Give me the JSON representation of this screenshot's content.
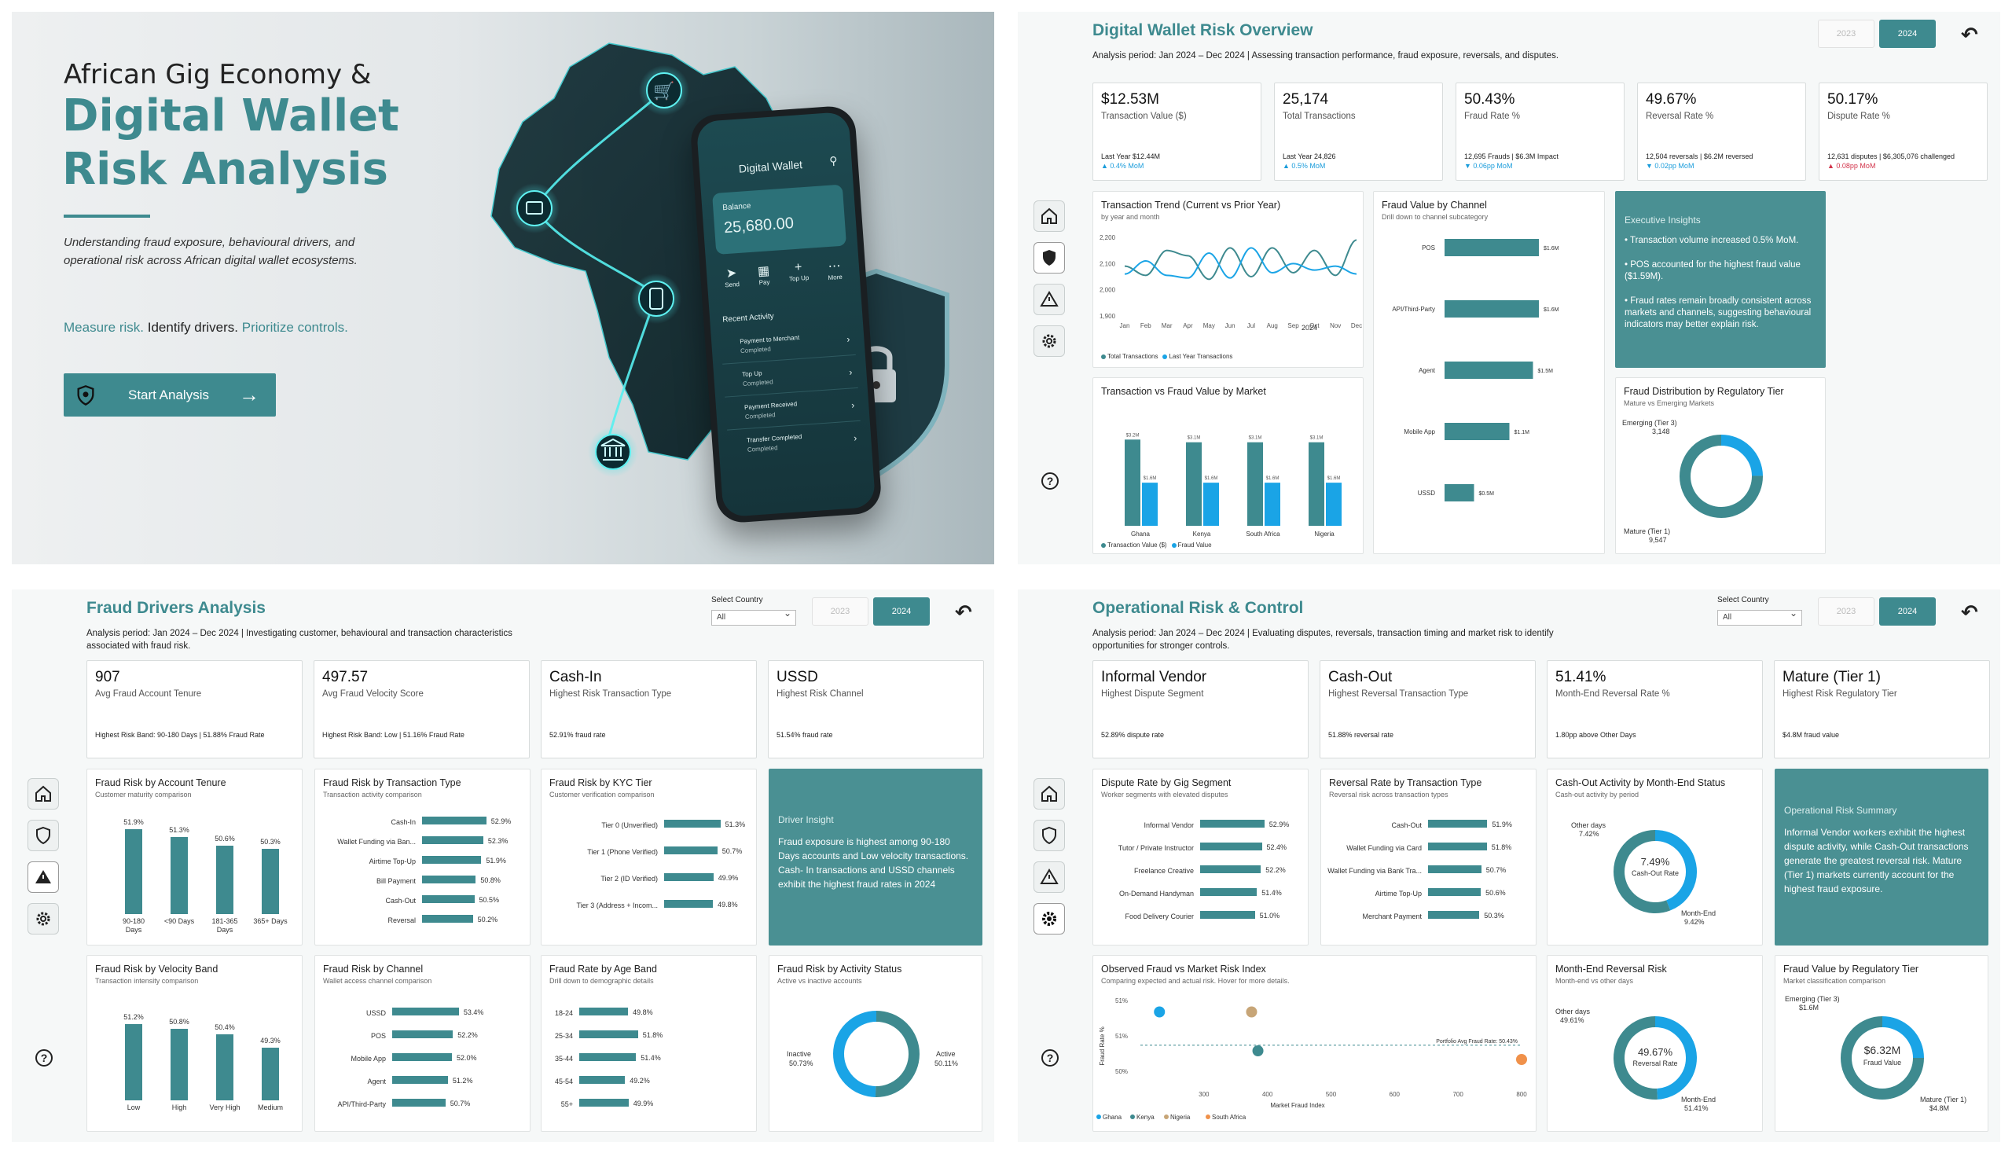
{
  "colors": {
    "teal": "#3e8a8f",
    "blue": "#1aa4e6",
    "dark": "#1b2f35"
  },
  "landing": {
    "eyebrow": "African Gig Economy &",
    "title_line1": "Digital Wallet",
    "title_line2": "Risk Analysis",
    "description": "Understanding fraud exposure, behavioural drivers, and operational risk across African digital wallet ecosystems.",
    "tagline_a": "Measure risk.",
    "tagline_b": " Identify drivers.",
    "tagline_c": " Prioritize controls.",
    "cta": "Start Analysis",
    "phone": {
      "title": "Digital Wallet",
      "balance_label": "Balance",
      "balance": "25,680.00",
      "actions": [
        "Send",
        "Pay",
        "Top Up",
        "More"
      ],
      "recent_title": "Recent Activity",
      "activity": [
        {
          "t": "Payment to Merchant",
          "s": "Completed"
        },
        {
          "t": "Top Up",
          "s": "Completed"
        },
        {
          "t": "Payment Received",
          "s": "Completed"
        },
        {
          "t": "Transfer Completed",
          "s": "Completed"
        }
      ]
    }
  },
  "overview": {
    "title": "Digital Wallet Risk Overview",
    "subtitle": "Analysis period: Jan 2024 – Dec 2024 | Assessing transaction performance, fraud exposure, reversals, and disputes.",
    "years": [
      "2023",
      "2024"
    ],
    "kpis": [
      {
        "value": "$12.53M",
        "label": "Transaction Value ($)",
        "note1": "Last Year $12.44M",
        "note2": "▲ 0.4% MoM",
        "dir": "up"
      },
      {
        "value": "25,174",
        "label": "Total Transactions",
        "note1": "Last Year 24,826",
        "note2": "▲ 0.5% MoM",
        "dir": "up"
      },
      {
        "value": "50.43%",
        "label": "Fraud Rate %",
        "note1": "12,695 Frauds | $6.3M Impact",
        "note2": "▼ 0.06pp MoM",
        "dir": "up"
      },
      {
        "value": "49.67%",
        "label": "Reversal Rate %",
        "note1": "12,504 reversals | $6.2M reversed",
        "note2": "▼ 0.02pp MoM",
        "dir": "up"
      },
      {
        "value": "50.17%",
        "label": "Dispute Rate %",
        "note1": "12,631 disputes | $6,305,076 challenged",
        "note2": "▲ 0.08pp MoM",
        "dir": "down"
      }
    ],
    "trend": {
      "title": "Transaction Trend (Current vs Prior Year)",
      "subtitle": "by year and month",
      "year_label": "2024",
      "legend": [
        "Total Transactions",
        "Last Year Transactions"
      ]
    },
    "market": {
      "title": "Transaction vs Fraud Value by Market",
      "legend": [
        "Transaction Value ($)",
        "Fraud Value"
      ]
    },
    "channel": {
      "title": "Fraud Value by Channel",
      "subtitle": "Drill down to channel subcategory"
    },
    "insights": {
      "title": "Executive Insights",
      "items": [
        "• Transaction volume increased 0.5% MoM.",
        "• POS accounted for the highest fraud value ($1.59M).",
        "• Fraud rates remain broadly consistent across markets and channels, suggesting behavioural indicators may better explain risk."
      ]
    },
    "tier": {
      "title": "Fraud Distribution by Regulatory Tier",
      "subtitle": "Mature vs Emerging Markets",
      "emerging_label": "Emerging (Tier 3)",
      "emerging_val": "3,148",
      "mature_label": "Mature (Tier 1)",
      "mature_val": "9,547"
    }
  },
  "drivers": {
    "title": "Fraud Drivers Analysis",
    "subtitle": "Analysis period: Jan 2024 – Dec 2024 | Investigating customer, behavioural and transaction characteristics associated with fraud risk.",
    "select_label": "Select Country",
    "select_value": "All",
    "kpis": [
      {
        "value": "907",
        "label": "Avg Fraud Account Tenure",
        "note": "Highest Risk Band: 90-180 Days | 51.88% Fraud Rate"
      },
      {
        "value": "497.57",
        "label": "Avg Fraud Velocity Score",
        "note": "Highest Risk Band: Low | 51.16% Fraud Rate"
      },
      {
        "value": "Cash-In",
        "label": "Highest Risk Transaction Type",
        "note": "52.91% fraud rate"
      },
      {
        "value": "USSD",
        "label": "Highest Risk Channel",
        "note": "51.54% fraud rate"
      }
    ],
    "tenure": {
      "title": "Fraud Risk by Account Tenure",
      "subtitle": "Customer maturity comparison"
    },
    "txtype": {
      "title": "Fraud Risk by Transaction Type",
      "subtitle": "Transaction activity comparison"
    },
    "kyc": {
      "title": "Fraud Risk by KYC Tier",
      "subtitle": "Customer verification comparison"
    },
    "insight": {
      "title": "Driver Insight",
      "text": "Fraud exposure is highest among 90-180 Days accounts and Low velocity transactions. Cash- In transactions and USSD channels exhibit the highest fraud rates in 2024"
    },
    "velocity": {
      "title": "Fraud Risk by Velocity Band",
      "subtitle": "Transaction intensity comparison"
    },
    "channel": {
      "title": "Fraud Risk by Channel",
      "subtitle": "Wallet access channel comparison"
    },
    "age": {
      "title": "Fraud Rate by Age Band",
      "subtitle": "Drill down to demographic details"
    },
    "activity": {
      "title": "Fraud Risk by Activity Status",
      "subtitle": "Active vs inactive accounts",
      "inactive_label": "Inactive",
      "inactive_val": "50.73%",
      "active_label": "Active",
      "active_val": "50.11%"
    }
  },
  "operational": {
    "title": "Operational Risk & Control",
    "subtitle": "Analysis period: Jan 2024 – Dec 2024 | Evaluating disputes, reversals, transaction timing and market risk to identify opportunities for stronger controls.",
    "select_label": "Select Country",
    "select_value": "All",
    "kpis": [
      {
        "value": "Informal Vendor",
        "label": "Highest Dispute Segment",
        "note": "52.89% dispute rate"
      },
      {
        "value": "Cash-Out",
        "label": "Highest Reversal Transaction Type",
        "note": "51.88% reversal rate"
      },
      {
        "value": "51.41%",
        "label": "Month-End Reversal Rate %",
        "note": "1.80pp above Other Days"
      },
      {
        "value": "Mature (Tier 1)",
        "label": "Highest Risk Regulatory Tier",
        "note": "$4.8M fraud value"
      }
    ],
    "dispute": {
      "title": "Dispute Rate by Gig Segment",
      "subtitle": "Worker segments with elevated disputes"
    },
    "reversal": {
      "title": "Reversal Rate by Transaction Type",
      "subtitle": "Reversal risk across transaction types"
    },
    "cashout": {
      "title": "Cash-Out Activity by Month-End Status",
      "subtitle": "Cash-out activity by period",
      "center_val": "7.49%",
      "center_lbl": "Cash-Out Rate",
      "other_label": "Other days",
      "other_val": "7.42%",
      "me_label": "Month-End",
      "me_val": "9.42%"
    },
    "summary": {
      "title": "Operational Risk Summary",
      "text": "Informal Vendor workers exhibit the highest dispute activity, while Cash-Out transactions generate the greatest reversal risk. Mature (Tier 1) markets currently account for the highest fraud exposure."
    },
    "scatter": {
      "title": "Observed Fraud vs Market Risk Index",
      "subtitle": "Comparing expected and actual risk. Hover for more details.",
      "xlabel": "Market Fraud Index",
      "ylabel": "Fraud Rate %",
      "ref_label": "Portfolio Avg Fraud Rate: 50.43%"
    },
    "monthend": {
      "title": "Month-End Reversal Risk",
      "subtitle": "Month-end vs other days",
      "center_val": "49.67%",
      "center_lbl": "Reversal Rate",
      "other_label": "Other days",
      "other_val": "49.61%",
      "me_label": "Month-End",
      "me_val": "51.41%"
    },
    "tierval": {
      "title": "Fraud Value by Regulatory Tier",
      "subtitle": "Market classification comparison",
      "center_val": "$6.32M",
      "center_lbl": "Fraud Value",
      "em_label": "Emerging (Tier 3)",
      "em_val": "$1.6M",
      "ma_label": "Mature (Tier 1)",
      "ma_val": "$4.8M"
    }
  },
  "chart_data": [
    {
      "type": "line",
      "title": "Transaction Trend (Current vs Prior Year)",
      "x": [
        "Jan",
        "Feb",
        "Mar",
        "Apr",
        "May",
        "Jun",
        "Jul",
        "Aug",
        "Sep",
        "Oct",
        "Nov",
        "Dec"
      ],
      "ylim": [
        1900,
        2200
      ],
      "yticks": [
        "2,200",
        "2,100",
        "2,000",
        "1,900"
      ],
      "series": [
        {
          "name": "Total Transactions",
          "values": [
            2090,
            2055,
            2150,
            2130,
            2040,
            2160,
            2050,
            2160,
            2065,
            2150,
            2055,
            2190
          ]
        },
        {
          "name": "Last Year Transactions",
          "values": [
            2060,
            2110,
            2055,
            2045,
            2140,
            2045,
            2160,
            2065,
            2100,
            2075,
            2090,
            2060
          ]
        }
      ]
    },
    {
      "type": "bar",
      "title": "Transaction vs Fraud Value by Market",
      "categories": [
        "Ghana",
        "Kenya",
        "South Africa",
        "Nigeria"
      ],
      "ylim": [
        0,
        3.5
      ],
      "series": [
        {
          "name": "Transaction Value ($)",
          "values": [
            3.2,
            3.1,
            3.1,
            3.1
          ],
          "labels": [
            "$3.2M",
            "$3.1M",
            "$3.1M",
            "$3.1M"
          ]
        },
        {
          "name": "Fraud Value",
          "values": [
            1.6,
            1.6,
            1.6,
            1.6
          ],
          "labels": [
            "$1.6M",
            "$1.6M",
            "$1.6M",
            "$1.6M"
          ]
        }
      ]
    },
    {
      "type": "bar",
      "title": "Fraud Value by Channel",
      "categories": [
        "POS",
        "API/Third-Party",
        "Agent",
        "Mobile App",
        "USSD"
      ],
      "values": [
        1.6,
        1.6,
        1.5,
        1.1,
        0.5
      ],
      "labels": [
        "$1.6M",
        "$1.6M",
        "$1.5M",
        "$1.1M",
        "$0.5M"
      ]
    },
    {
      "type": "pie",
      "title": "Fraud Distribution by Regulatory Tier",
      "categories": [
        "Emerging (Tier 3)",
        "Mature (Tier 1)"
      ],
      "values": [
        3148,
        9547
      ]
    },
    {
      "type": "bar",
      "title": "Fraud Risk by Account Tenure",
      "categories": [
        "90-180 Days",
        "<90 Days",
        "181-365 Days",
        "365+ Days"
      ],
      "values": [
        51.9,
        51.3,
        50.6,
        50.3
      ],
      "labels": [
        "51.9%",
        "51.3%",
        "50.6%",
        "50.3%"
      ]
    },
    {
      "type": "bar",
      "title": "Fraud Risk by Transaction Type",
      "categories": [
        "Cash-In",
        "Wallet Funding via Ban...",
        "Airtime Top-Up",
        "Bill Payment",
        "Cash-Out",
        "Reversal"
      ],
      "values": [
        52.9,
        52.3,
        51.9,
        50.8,
        50.5,
        50.2
      ],
      "labels": [
        "52.9%",
        "52.3%",
        "51.9%",
        "50.8%",
        "50.5%",
        "50.2%"
      ]
    },
    {
      "type": "bar",
      "title": "Fraud Risk by KYC Tier",
      "categories": [
        "Tier 0 (Unverified)",
        "Tier 1 (Phone Verified)",
        "Tier 2 (ID Verified)",
        "Tier 3 (Address + Incom..."
      ],
      "values": [
        51.3,
        50.7,
        49.9,
        49.8
      ],
      "labels": [
        "51.3%",
        "50.7%",
        "49.9%",
        "49.8%"
      ]
    },
    {
      "type": "bar",
      "title": "Fraud Risk by Velocity Band",
      "categories": [
        "Low",
        "High",
        "Very High",
        "Medium"
      ],
      "values": [
        51.2,
        50.8,
        50.4,
        49.3
      ],
      "labels": [
        "51.2%",
        "50.8%",
        "50.4%",
        "49.3%"
      ]
    },
    {
      "type": "bar",
      "title": "Fraud Risk by Channel",
      "categories": [
        "USSD",
        "POS",
        "Mobile App",
        "Agent",
        "API/Third-Party"
      ],
      "values": [
        53.4,
        52.2,
        52.0,
        51.2,
        50.7
      ],
      "labels": [
        "53.4%",
        "52.2%",
        "52.0%",
        "51.2%",
        "50.7%"
      ]
    },
    {
      "type": "bar",
      "title": "Fraud Rate by Age Band",
      "categories": [
        "18-24",
        "25-34",
        "35-44",
        "45-54",
        "55+"
      ],
      "values": [
        49.8,
        51.8,
        51.4,
        49.2,
        49.9
      ],
      "labels": [
        "49.8%",
        "51.8%",
        "51.4%",
        "49.2%",
        "49.9%"
      ]
    },
    {
      "type": "pie",
      "title": "Fraud Risk by Activity Status",
      "categories": [
        "Inactive",
        "Active"
      ],
      "values": [
        50.73,
        50.11
      ]
    },
    {
      "type": "bar",
      "title": "Dispute Rate by Gig Segment",
      "categories": [
        "Informal Vendor",
        "Tutor / Private Instructor",
        "Freelance Creative",
        "On-Demand Handyman",
        "Food Delivery Courier"
      ],
      "values": [
        52.9,
        52.4,
        52.2,
        51.4,
        51.0
      ],
      "labels": [
        "52.9%",
        "52.4%",
        "52.2%",
        "51.4%",
        "51.0%"
      ]
    },
    {
      "type": "bar",
      "title": "Reversal Rate by Transaction Type",
      "categories": [
        "Cash-Out",
        "Wallet Funding via Card",
        "Wallet Funding via Bank Tra...",
        "Airtime Top-Up",
        "Merchant Payment"
      ],
      "values": [
        51.9,
        51.8,
        50.7,
        50.6,
        50.3
      ],
      "labels": [
        "51.9%",
        "51.8%",
        "50.7%",
        "50.6%",
        "50.3%"
      ]
    },
    {
      "type": "pie",
      "title": "Cash-Out Activity by Month-End Status",
      "categories": [
        "Other days",
        "Month-End"
      ],
      "values": [
        7.42,
        9.42
      ]
    },
    {
      "type": "scatter",
      "title": "Observed Fraud vs Market Risk Index",
      "xlabel": "Market Fraud Index",
      "ylabel": "Fraud Rate %",
      "xlim": [
        200,
        800
      ],
      "ylim": [
        49.5,
        51.5
      ],
      "xticks": [
        300,
        400,
        500,
        600,
        700,
        800
      ],
      "yticks": [
        "51%",
        "51%",
        "50%"
      ],
      "series": [
        {
          "name": "Ghana",
          "x": [
            230
          ],
          "y": [
            51.2
          ]
        },
        {
          "name": "Kenya",
          "x": [
            385
          ],
          "y": [
            50.3
          ]
        },
        {
          "name": "Nigeria",
          "x": [
            375
          ],
          "y": [
            51.2
          ]
        },
        {
          "name": "South Africa",
          "x": [
            800
          ],
          "y": [
            50.1
          ]
        }
      ],
      "reference": 50.43
    },
    {
      "type": "pie",
      "title": "Month-End Reversal Risk",
      "categories": [
        "Other days",
        "Month-End"
      ],
      "values": [
        49.61,
        51.41
      ]
    },
    {
      "type": "pie",
      "title": "Fraud Value by Regulatory Tier",
      "categories": [
        "Emerging (Tier 3)",
        "Mature (Tier 1)"
      ],
      "values": [
        1.6,
        4.8
      ]
    }
  ]
}
